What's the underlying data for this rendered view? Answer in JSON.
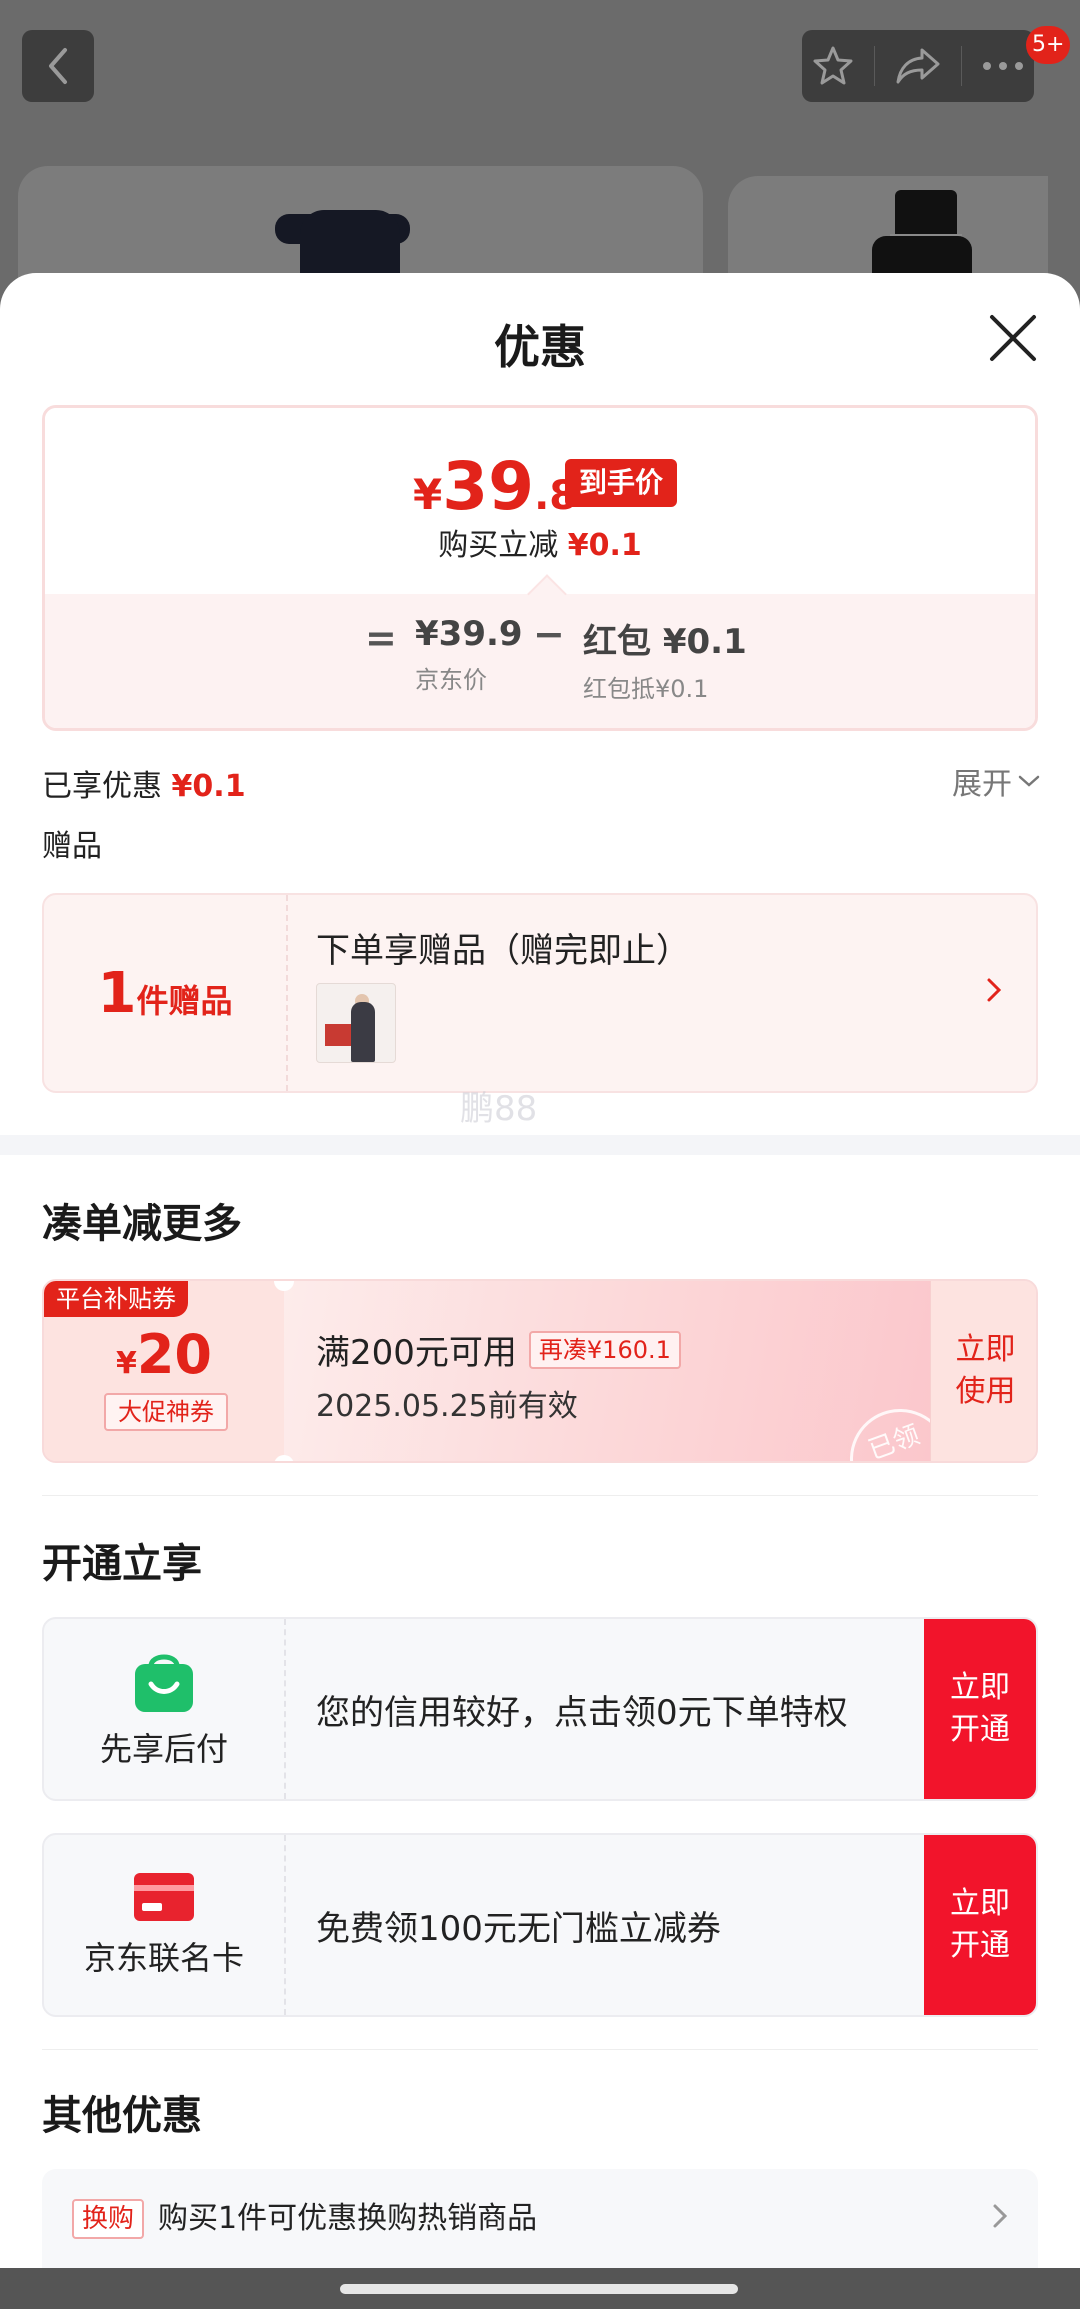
{
  "topbar": {
    "notification_badge": "5+"
  },
  "sheet": {
    "title": "优惠",
    "price_card": {
      "yen": "¥",
      "price_int": "39",
      "price_dec": ".8",
      "price_tag": "到手价",
      "instant_label": "购买立减",
      "instant_value": "¥0.1",
      "equals": "=",
      "jd_price_value": "¥39.9",
      "jd_price_label": "京东价",
      "minus": "−",
      "redpack_value": "红包 ¥0.1",
      "redpack_label": "红包抵¥0.1"
    },
    "enjoyed_label": "已享优惠",
    "enjoyed_value": "¥0.1",
    "expand_label": "展开",
    "gift_section_label": "赠品",
    "gift": {
      "count": "1",
      "count_unit": "件赠品",
      "title": "下单享赠品（赠完即止）"
    },
    "watermark": "鹏88",
    "more_section_title": "凑单减更多",
    "coupon": {
      "platform_tag": "平台补贴券",
      "yen": "¥",
      "amount": "20",
      "promo_tag": "大促神券",
      "condition": "满200元可用",
      "addon_tag": "再凑¥160.1",
      "expiry": "2025.05.25前有效",
      "use_btn_line1": "立即",
      "use_btn_line2": "使用",
      "stamp": "已领"
    },
    "open_section_title": "开通立享",
    "open_items": [
      {
        "label": "先享后付",
        "text": "您的信用较好，点击领0元下单特权",
        "btn_line1": "立即",
        "btn_line2": "开通"
      },
      {
        "label": "京东联名卡",
        "text": "免费领100元无门槛立减券",
        "btn_line1": "立即",
        "btn_line2": "开通"
      }
    ],
    "other_section_title": "其他优惠",
    "other": {
      "tag": "换购",
      "text": "购买1件可优惠换购热销商品"
    }
  },
  "colors": {
    "accent_red": "#e2231a",
    "button_red": "#f2142b",
    "pay_green": "#1fbf6a"
  },
  "icons": [
    "back-arrow-icon",
    "star-icon",
    "share-icon",
    "more-dots-icon",
    "close-icon",
    "chevron-down-icon",
    "chevron-right-icon",
    "shopping-bag-icon",
    "credit-card-icon"
  ]
}
